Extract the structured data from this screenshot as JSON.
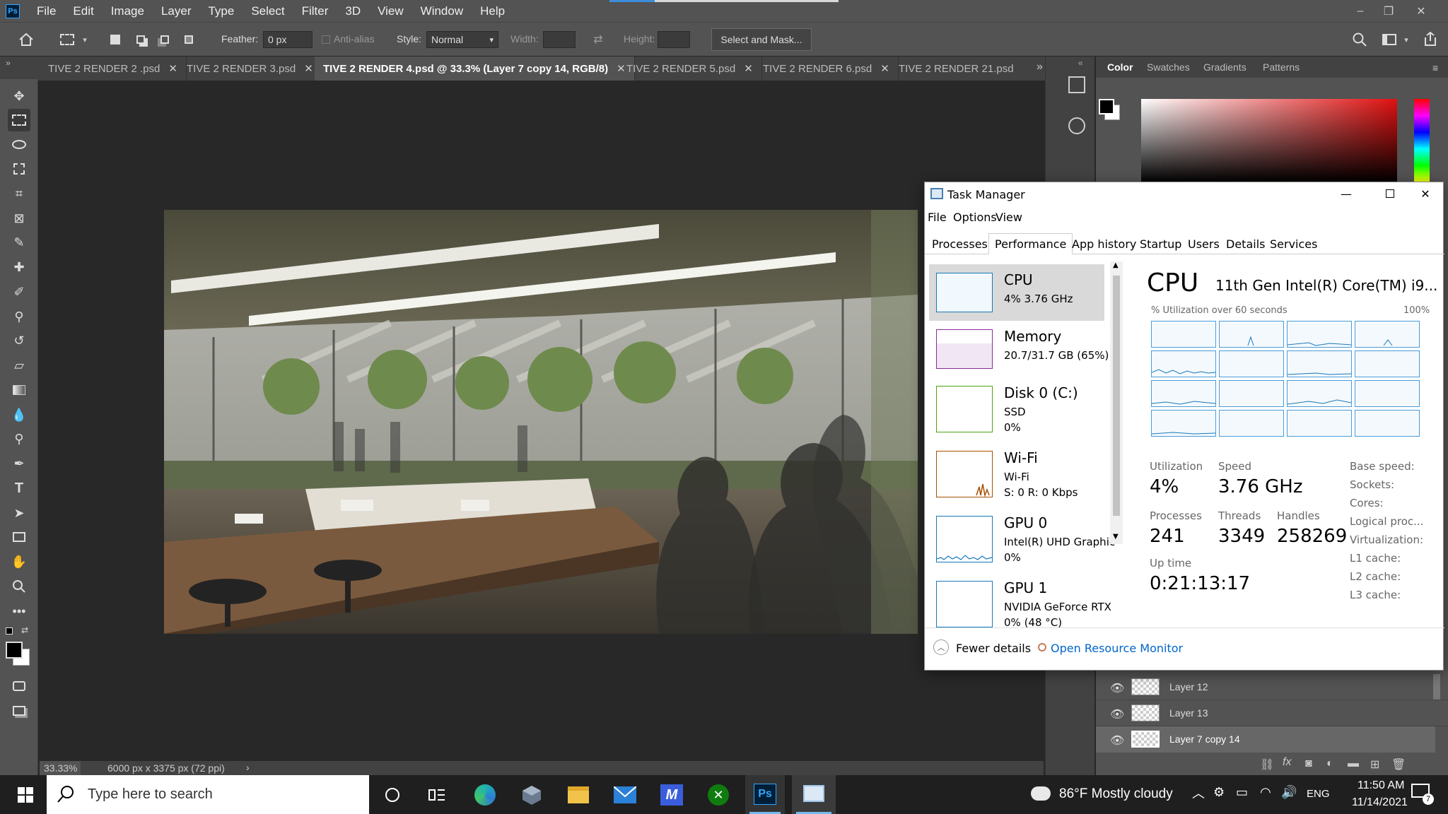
{
  "menubar": {
    "items": [
      "File",
      "Edit",
      "Image",
      "Layer",
      "Type",
      "Select",
      "Filter",
      "3D",
      "View",
      "Window",
      "Help"
    ],
    "logo": "Ps"
  },
  "options": {
    "feather_label": "Feather:",
    "feather_value": "0 px",
    "antialias_label": "Anti-alias",
    "style_label": "Style:",
    "style_value": "Normal",
    "width_label": "Width:",
    "height_label": "Height:",
    "select_mask": "Select and Mask..."
  },
  "tabs": [
    {
      "label": "TIVE 2 RENDER 2 .psd"
    },
    {
      "label": "TIVE 2 RENDER 3.psd"
    },
    {
      "label": "TIVE 2 RENDER 4.psd @ 33.3% (Layer 7 copy 14, RGB/8)"
    },
    {
      "label": "TIVE 2 RENDER 5.psd"
    },
    {
      "label": "TIVE 2 RENDER 6.psd"
    },
    {
      "label": "TIVE 2 RENDER 21.psd"
    }
  ],
  "status": {
    "zoom": "33.33%",
    "docsize": "6000 px x 3375 px (72 ppi)",
    "arrow": "›"
  },
  "colorpanel": {
    "tabs": [
      "Color",
      "Swatches",
      "Gradients",
      "Patterns"
    ]
  },
  "layers": [
    {
      "name": "Layer 12"
    },
    {
      "name": "Layer 13"
    },
    {
      "name": "Layer 7 copy 14"
    }
  ],
  "taskmanager": {
    "title": "Task Manager",
    "menu": [
      "File",
      "Options",
      "View"
    ],
    "tabs": [
      "Processes",
      "Performance",
      "App history",
      "Startup",
      "Users",
      "Details",
      "Services"
    ],
    "items": [
      {
        "name": "CPU",
        "l1": "4%  3.76 GHz",
        "l2": "",
        "color": "#1779ba"
      },
      {
        "name": "Memory",
        "l1": "20.7/31.7 GB (65%)",
        "l2": "",
        "color": "#8b2a9b"
      },
      {
        "name": "Disk 0 (C:)",
        "l1": "SSD",
        "l2": "0%",
        "color": "#4da60c"
      },
      {
        "name": "Wi-Fi",
        "l1": "Wi-Fi",
        "l2": "S: 0  R: 0 Kbps",
        "color": "#a74f01"
      },
      {
        "name": "GPU 0",
        "l1": "Intel(R) UHD Graphic",
        "l2": "0%",
        "color": "#1779ba"
      },
      {
        "name": "GPU 1",
        "l1": "NVIDIA GeForce RTX",
        "l2": "0%  (48 °C)",
        "color": "#1779ba"
      }
    ],
    "cpu_title": "CPU",
    "cpu_model": "11th Gen Intel(R) Core(TM) i9...",
    "util_caption": "% Utilization over 60 seconds",
    "util_max": "100%",
    "stats": {
      "utilization_label": "Utilization",
      "utilization": "4%",
      "speed_label": "Speed",
      "speed": "3.76 GHz",
      "processes_label": "Processes",
      "processes": "241",
      "threads_label": "Threads",
      "threads": "3349",
      "handles_label": "Handles",
      "handles": "258269",
      "uptime_label": "Up time",
      "uptime": "0:21:13:17"
    },
    "side": [
      "Base speed:",
      "Sockets:",
      "Cores:",
      "Logical proc...",
      "Virtualization:",
      "L1 cache:",
      "L2 cache:",
      "L3 cache:"
    ],
    "fewer": "Fewer details",
    "resmon": "Open Resource Monitor"
  },
  "taskbar": {
    "search_placeholder": "Type here to search",
    "weather": "86°F  Mostly cloudy",
    "lang": "ENG",
    "time": "11:50 AM",
    "date": "11/14/2021",
    "notif": "7"
  }
}
